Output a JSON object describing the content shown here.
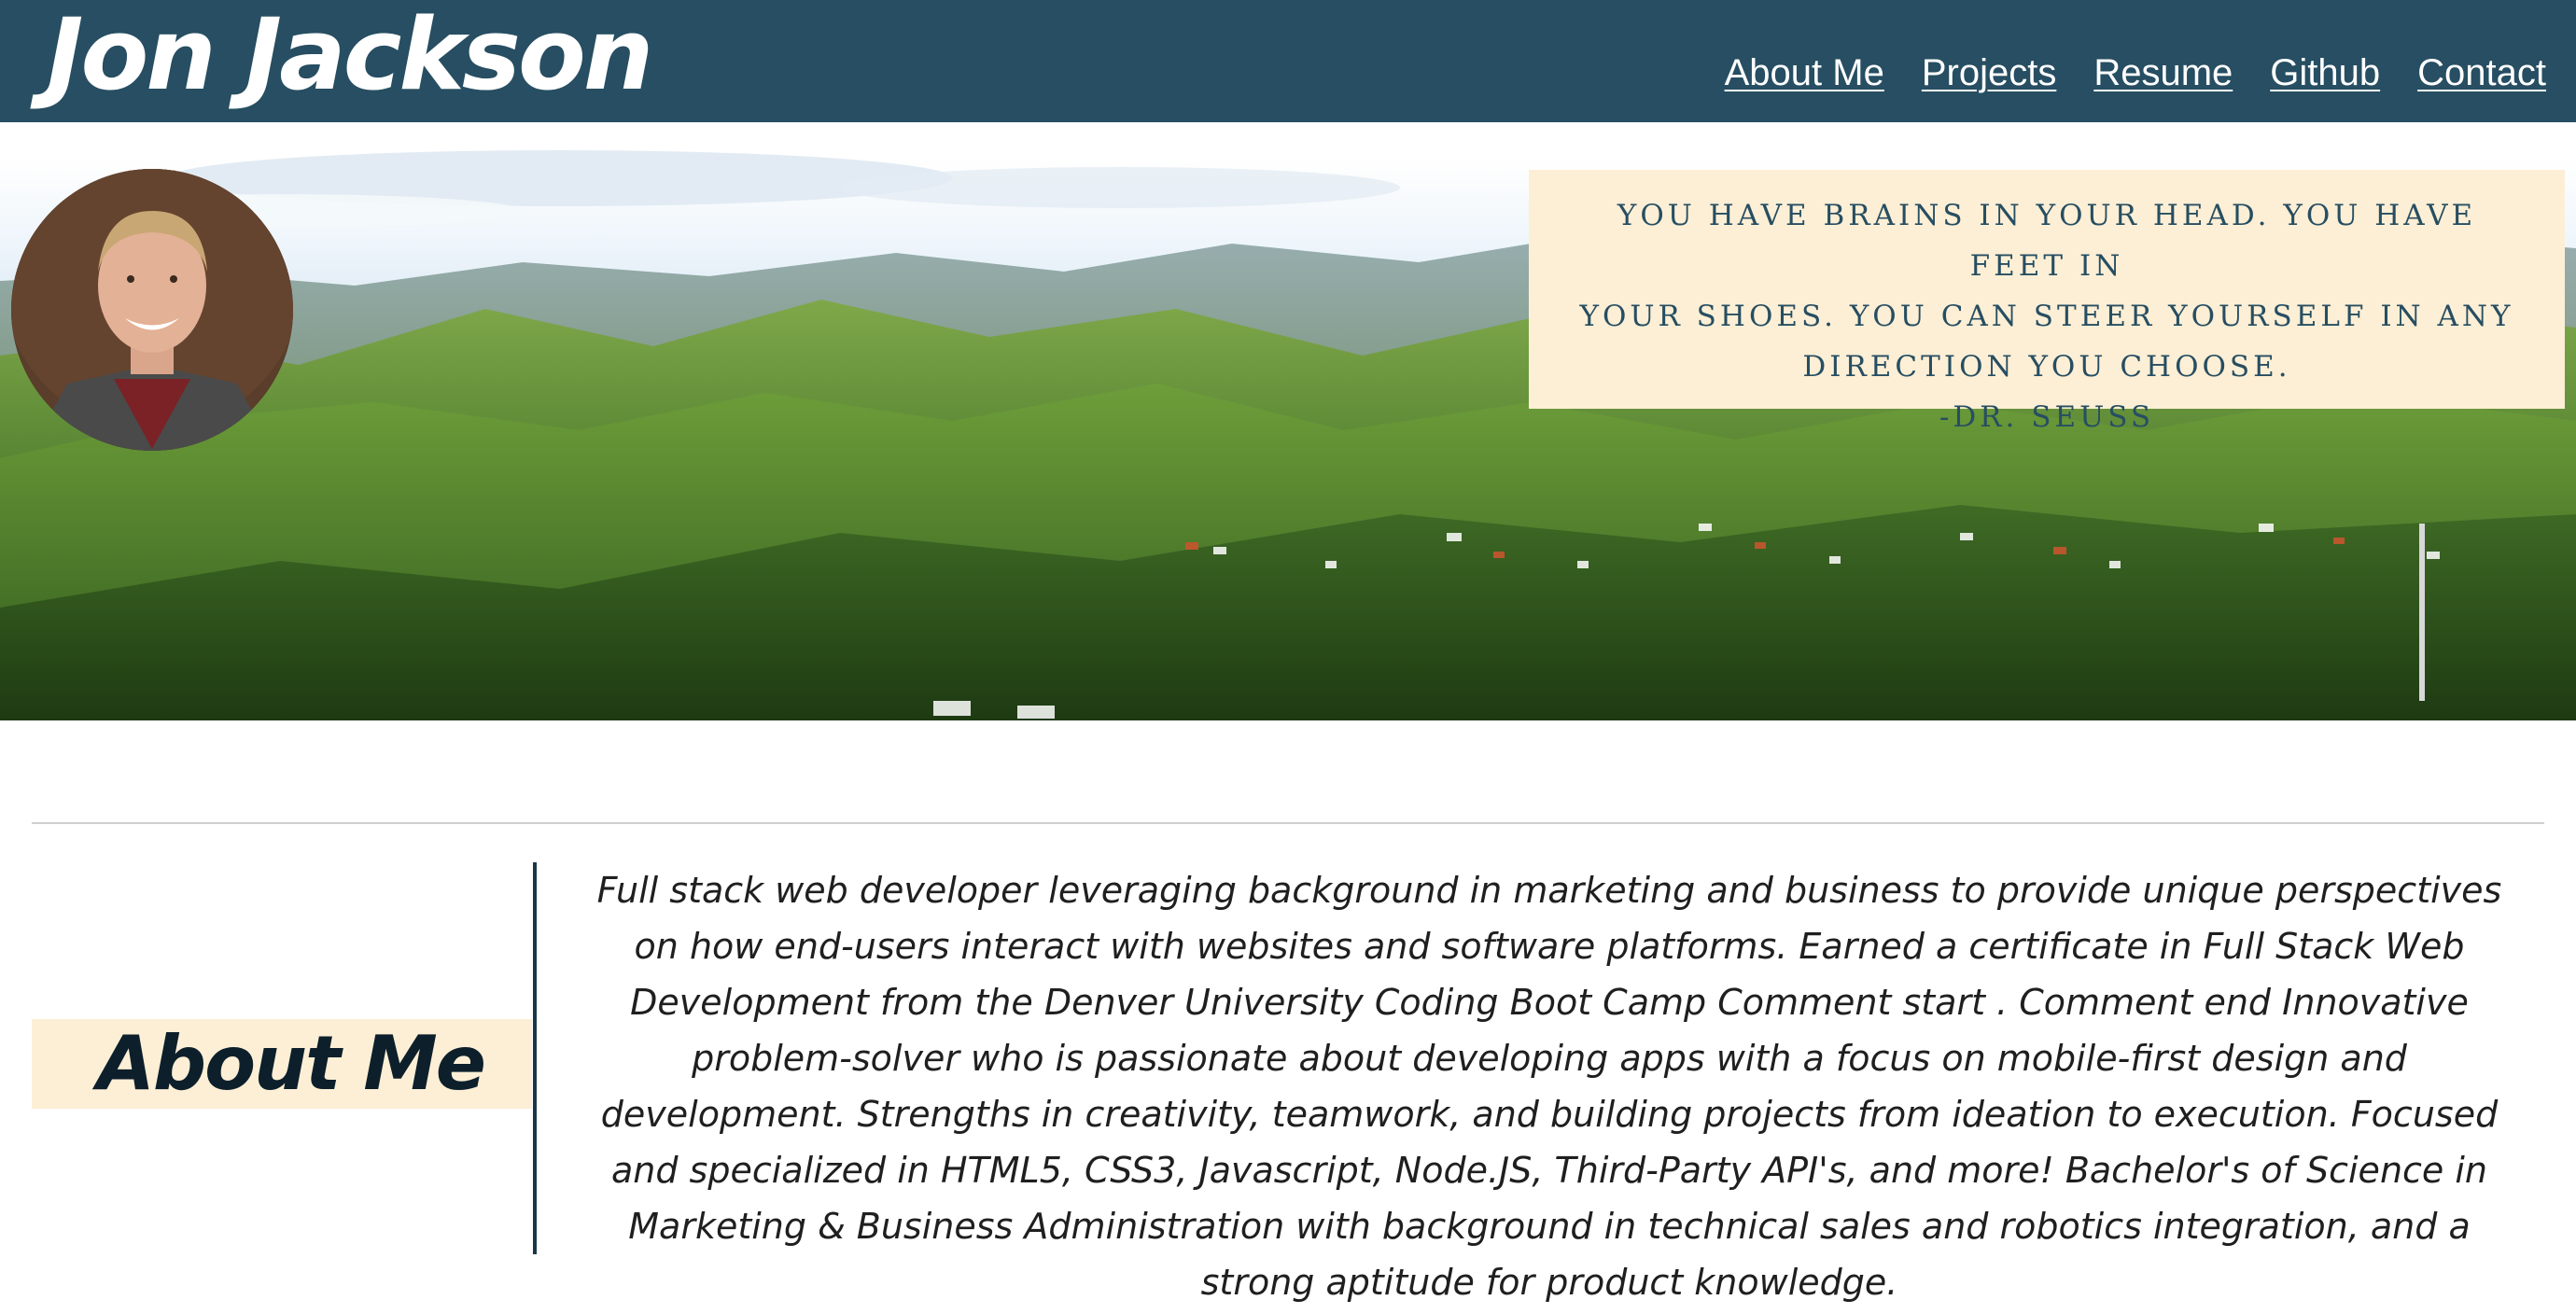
{
  "header": {
    "title": "Jon Jackson",
    "nav": [
      {
        "label": "About Me"
      },
      {
        "label": "Projects"
      },
      {
        "label": "Resume"
      },
      {
        "label": "Github"
      },
      {
        "label": "Contact"
      }
    ]
  },
  "hero": {
    "quote_lines": [
      "You have brains in your head. You have feet in",
      "your shoes. You can steer yourself in any",
      "direction you choose."
    ],
    "quote_author": "-Dr. Seuss"
  },
  "about": {
    "heading": "About Me",
    "body": "Full stack web developer leveraging background in marketing and business to provide unique perspectives on how end-users interact with websites and software platforms. Earned a certificate in Full Stack Web Development from the Denver University Coding Boot Camp Comment start . Comment end Innovative problem-solver who is passionate about developing apps with a focus on mobile-first design and development. Strengths in creativity, teamwork, and building projects from ideation to execution. Focused and specialized in HTML5, CSS3, Javascript, Node.JS, Third-Party API's, and more! Bachelor's of Science in Marketing & Business Administration with background in technical sales and robotics integration, and a strong aptitude for product knowledge."
  },
  "colors": {
    "header_bg": "#274e62",
    "accent_cream": "#fdefd5",
    "heading_text": "#0d1f2b"
  }
}
